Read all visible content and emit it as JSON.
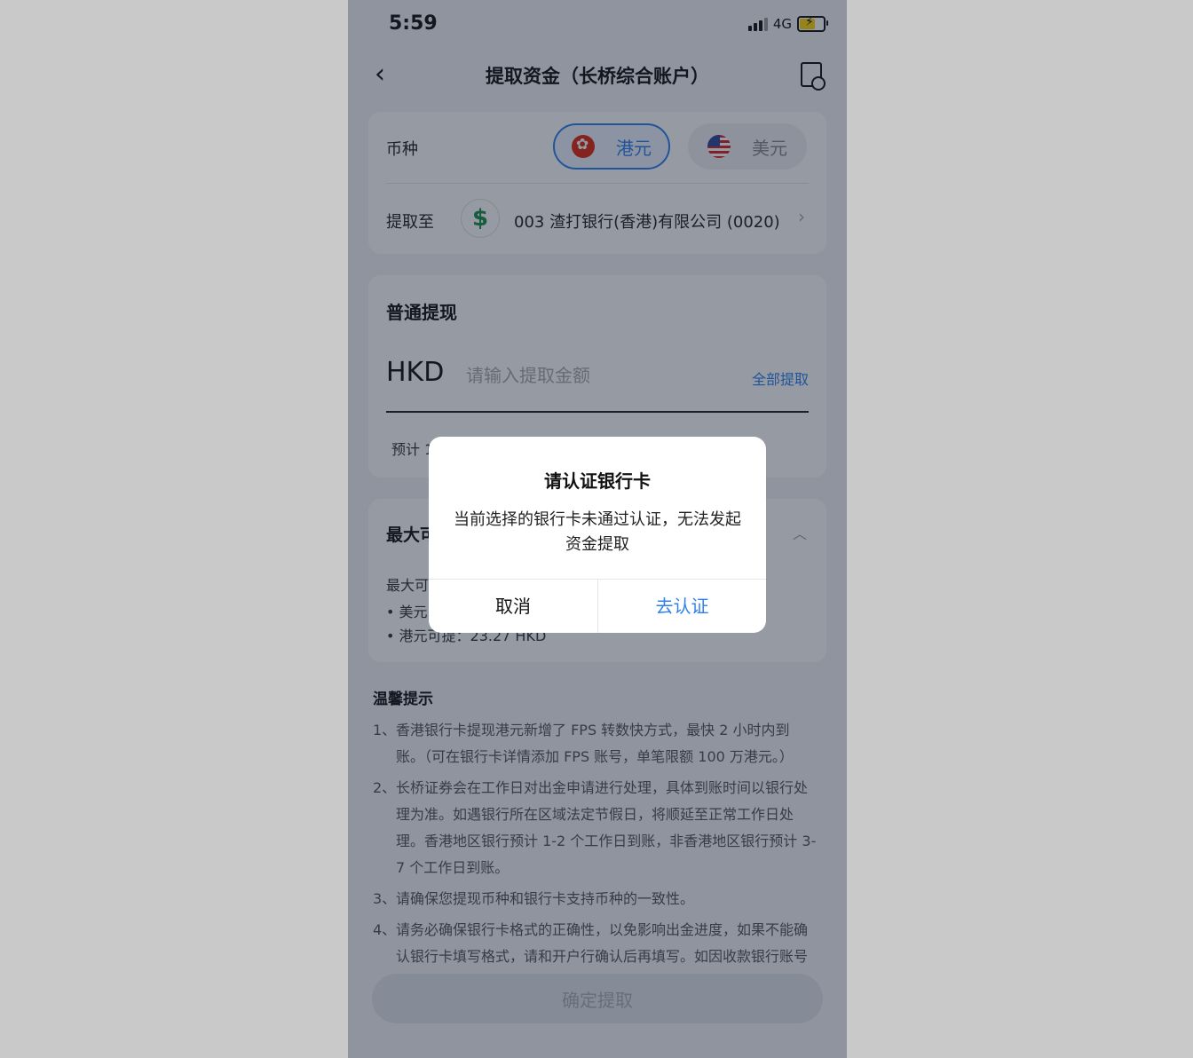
{
  "status_bar": {
    "time": "5:59",
    "network": "4G"
  },
  "nav": {
    "title": "提取资金（长桥综合账户）"
  },
  "currency": {
    "label": "币种",
    "options": [
      {
        "label": "港元",
        "selected": true
      },
      {
        "label": "美元",
        "selected": false
      }
    ]
  },
  "withdraw_to": {
    "label": "提取至",
    "bank": "003 渣打银行(香港)有限公司 (0020)"
  },
  "normal_withdraw": {
    "title": "普通提现",
    "currency_code": "HKD",
    "amount_placeholder": "请输入提取金额",
    "amount_value": "",
    "withdraw_all": "全部提取",
    "estimate_text": "预计 1"
  },
  "max_withdraw": {
    "title": "最大可",
    "subtitle": "最大可",
    "items": [
      "美元",
      "港元可提：23.27 HKD"
    ]
  },
  "tips": {
    "title": "温馨提示",
    "items": [
      {
        "num": "1、",
        "text": "香港银行卡提现港元新增了 FPS 转数快方式，最快 2 小时内到账。（可在银行卡详情添加 FPS 账号，单笔限额 100 万港元。）"
      },
      {
        "num": "2、",
        "text": "长桥证券会在工作日对出金申请进行处理，具体到账时间以银行处理为准。如遇银行所在区域法定节假日，将顺延至正常工作日处理。香港地区银行预计 1-2 个工作日到账，非香港地区银行预计 3-7 个工作日到账。"
      },
      {
        "num": "3、",
        "text": "请确保您提现币种和银行卡支持币种的一致性。"
      },
      {
        "num": "4、",
        "text": "请务必确保银行卡格式的正确性，以免影响出金进度，如果不能确认银行卡填写格式，请和开户行确认后再填写。如因收款银行账号"
      }
    ]
  },
  "confirm_button": "确定提取",
  "dialog": {
    "title": "请认证银行卡",
    "message": "当前选择的银行卡未通过认证，无法发起资金提取",
    "cancel": "取消",
    "confirm": "去认证"
  },
  "colors": {
    "accent": "#2f80ed",
    "overlay": "rgba(20,30,50,0.45)"
  }
}
